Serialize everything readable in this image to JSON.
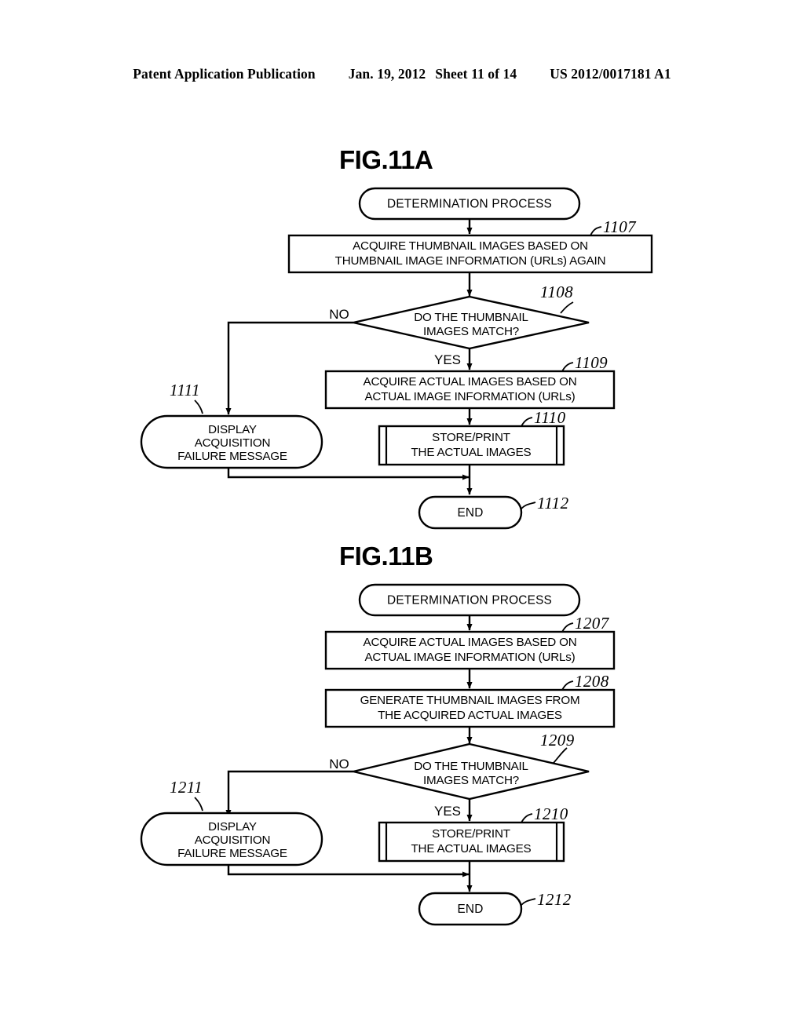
{
  "header": {
    "publication": "Patent Application Publication",
    "date": "Jan. 19, 2012",
    "sheet": "Sheet 11 of 14",
    "doc_number": "US 2012/0017181 A1"
  },
  "figures": [
    {
      "title": "FIG.11A",
      "nodes": {
        "start": "DETERMINATION PROCESS",
        "step_1107_line1": "ACQUIRE THUMBNAIL IMAGES BASED ON",
        "step_1107_line2": "THUMBNAIL IMAGE INFORMATION (URLs) AGAIN",
        "decision_1108_line1": "DO THE THUMBNAIL",
        "decision_1108_line2": "IMAGES MATCH?",
        "step_1109_line1": "ACQUIRE ACTUAL IMAGES BASED ON",
        "step_1109_line2": "ACTUAL IMAGE INFORMATION (URLs)",
        "step_1110_line1": "STORE/PRINT",
        "step_1110_line2": "THE ACTUAL IMAGES",
        "step_1111_line1": "DISPLAY",
        "step_1111_line2": "ACQUISITION",
        "step_1111_line3": "FAILURE MESSAGE",
        "end": "END"
      },
      "branch_labels": {
        "no": "NO",
        "yes": "YES"
      },
      "ref_numbers": {
        "step_1107": "1107",
        "decision_1108": "1108",
        "step_1109": "1109",
        "step_1110": "1110",
        "step_1111": "1111",
        "end_1112": "1112"
      }
    },
    {
      "title": "FIG.11B",
      "nodes": {
        "start": "DETERMINATION PROCESS",
        "step_1207_line1": "ACQUIRE ACTUAL IMAGES BASED ON",
        "step_1207_line2": "ACTUAL IMAGE INFORMATION (URLs)",
        "step_1208_line1": "GENERATE THUMBNAIL IMAGES FROM",
        "step_1208_line2": "THE ACQUIRED ACTUAL IMAGES",
        "decision_1209_line1": "DO THE THUMBNAIL",
        "decision_1209_line2": "IMAGES MATCH?",
        "step_1210_line1": "STORE/PRINT",
        "step_1210_line2": "THE ACTUAL IMAGES",
        "step_1211_line1": "DISPLAY",
        "step_1211_line2": "ACQUISITION",
        "step_1211_line3": "FAILURE MESSAGE",
        "end": "END"
      },
      "branch_labels": {
        "no": "NO",
        "yes": "YES"
      },
      "ref_numbers": {
        "step_1207": "1207",
        "step_1208": "1208",
        "decision_1209": "1209",
        "step_1210": "1210",
        "step_1211": "1211",
        "end_1212": "1212"
      }
    }
  ],
  "colors": {
    "ink": "#000000",
    "paper": "#ffffff"
  }
}
